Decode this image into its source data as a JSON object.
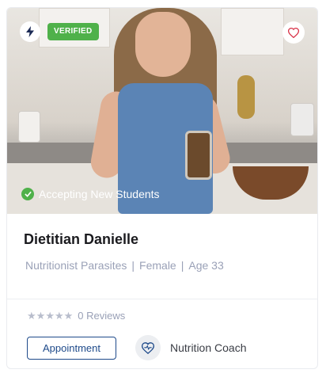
{
  "profile": {
    "verified_label": "VERIFIED",
    "accepting_label": "Accepting New Students",
    "name": "Dietitian Danielle",
    "specialty": "Nutritionist Parasites",
    "gender": "Female",
    "age": "Age 33",
    "separator": "|",
    "rating": {
      "stars": 0,
      "max_stars": 5,
      "reviews_label": "0 Reviews"
    },
    "appointment_label": "Appointment",
    "coach_type": "Nutrition Coach"
  },
  "icons": {
    "bolt": "lightning-bolt-icon",
    "heart": "heart-outline-icon",
    "check": "check-circle-icon",
    "star": "star-icon",
    "coach": "heart-pulse-icon"
  },
  "colors": {
    "verified": "#4fb14a",
    "heart": "#d9354a",
    "primary": "#1e4a8a",
    "muted": "#9aa1b7",
    "star_empty": "#b8bdcc"
  }
}
